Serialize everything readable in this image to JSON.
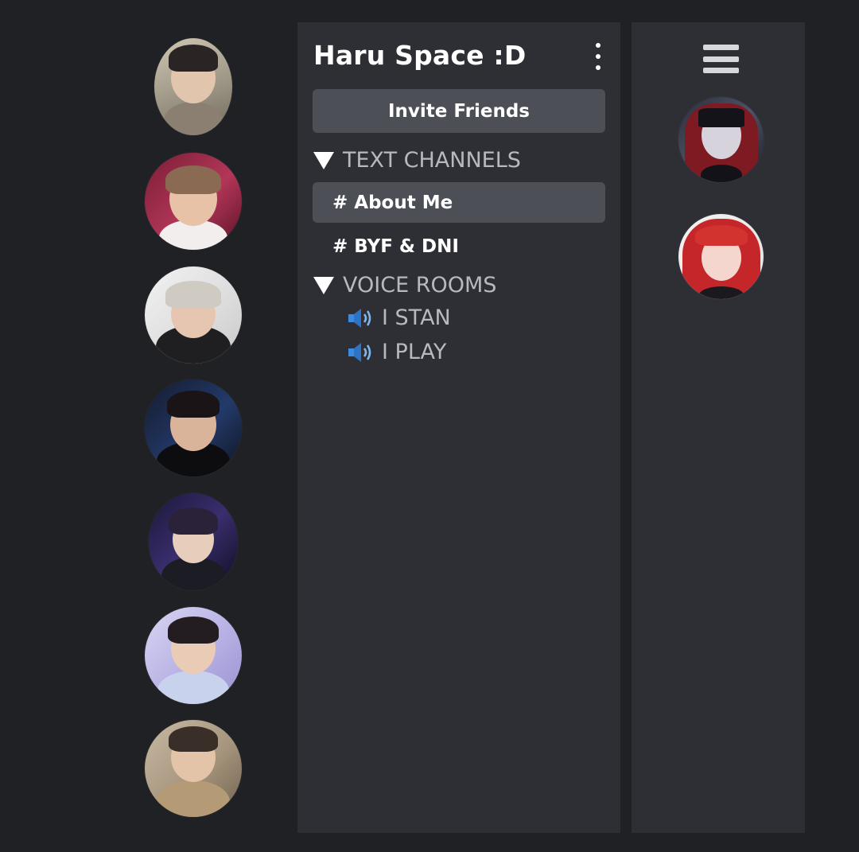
{
  "server": {
    "name": "Haru Space :D",
    "options_icon": "kebab-menu-icon",
    "invite_label": "Invite Friends"
  },
  "text_channels": {
    "label": "TEXT CHANNELS",
    "collapse_icon": "triangle-down-icon",
    "items": [
      {
        "hash": "#",
        "name": "About Me",
        "active": true
      },
      {
        "hash": "#",
        "name": "BYF & DNI",
        "active": false
      }
    ]
  },
  "voice_rooms": {
    "label": "VOICE ROOMS",
    "collapse_icon": "triangle-down-icon",
    "speaker_icon": "speaker-icon",
    "items": [
      {
        "name": "I STAN"
      },
      {
        "name": "I PLAY"
      }
    ]
  },
  "server_rail": {
    "avatar_count": 7
  },
  "members_panel": {
    "menu_icon": "hamburger-menu-icon",
    "member_count": 2
  },
  "colors": {
    "background": "#202125",
    "panel": "#2e2f34",
    "active_item": "#4c4f56",
    "muted_text": "#b7b9bf",
    "white": "#ffffff"
  }
}
